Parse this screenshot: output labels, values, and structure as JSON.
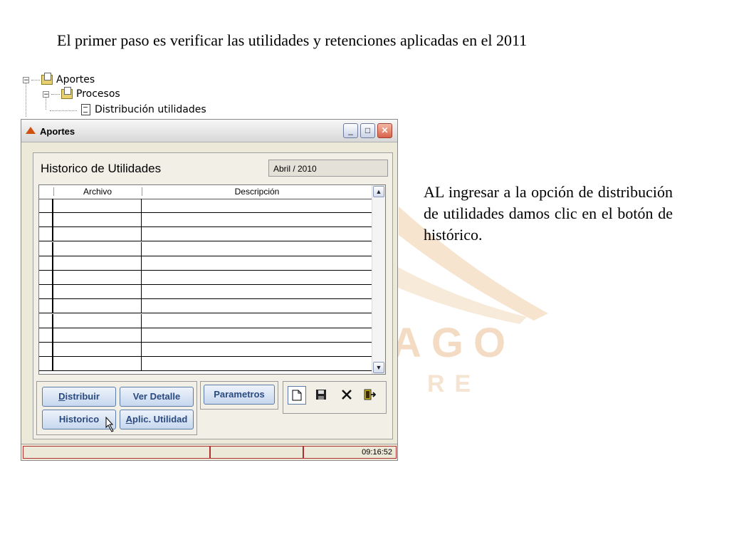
{
  "slide": {
    "title": "El primer paso es verificar las utilidades y retenciones aplicadas en el 2011",
    "body_text": "AL ingresar a la opción de distribución de utilidades damos clic en el botón de histórico."
  },
  "watermark": {
    "line1": "AGO",
    "line2": "RE"
  },
  "tree": {
    "items": [
      {
        "label": "Aportes",
        "icon": "folder-icon"
      },
      {
        "label": "Procesos",
        "icon": "folder-icon"
      },
      {
        "label": "Distribución utilidades",
        "icon": "document-icon"
      }
    ]
  },
  "window": {
    "title": "Aportes",
    "controls": {
      "minimize": "_",
      "maximize": "□",
      "close": "✕"
    },
    "panel_title": "Historico de Utilidades",
    "period": "Abril / 2010",
    "grid": {
      "columns": [
        "Archivo",
        "Descripción"
      ],
      "rows": [
        "",
        "",
        "",
        "",
        "",
        "",
        "",
        "",
        "",
        "",
        "",
        ""
      ]
    },
    "buttons": {
      "distribuir": "Distribuir",
      "ver_detalle": "Ver Detalle",
      "parametros": "Parametros",
      "historico": "Historico",
      "aplic_utilidad": "Aplic. Utilidad"
    },
    "toolbar_icons": [
      "new-document-icon",
      "save-icon",
      "delete-icon",
      "exit-icon"
    ],
    "status": {
      "time": "09:16:52"
    }
  },
  "colors": {
    "button_text": "#2a4a80",
    "status_border": "#b03030",
    "watermark": "#f3dcc3"
  }
}
